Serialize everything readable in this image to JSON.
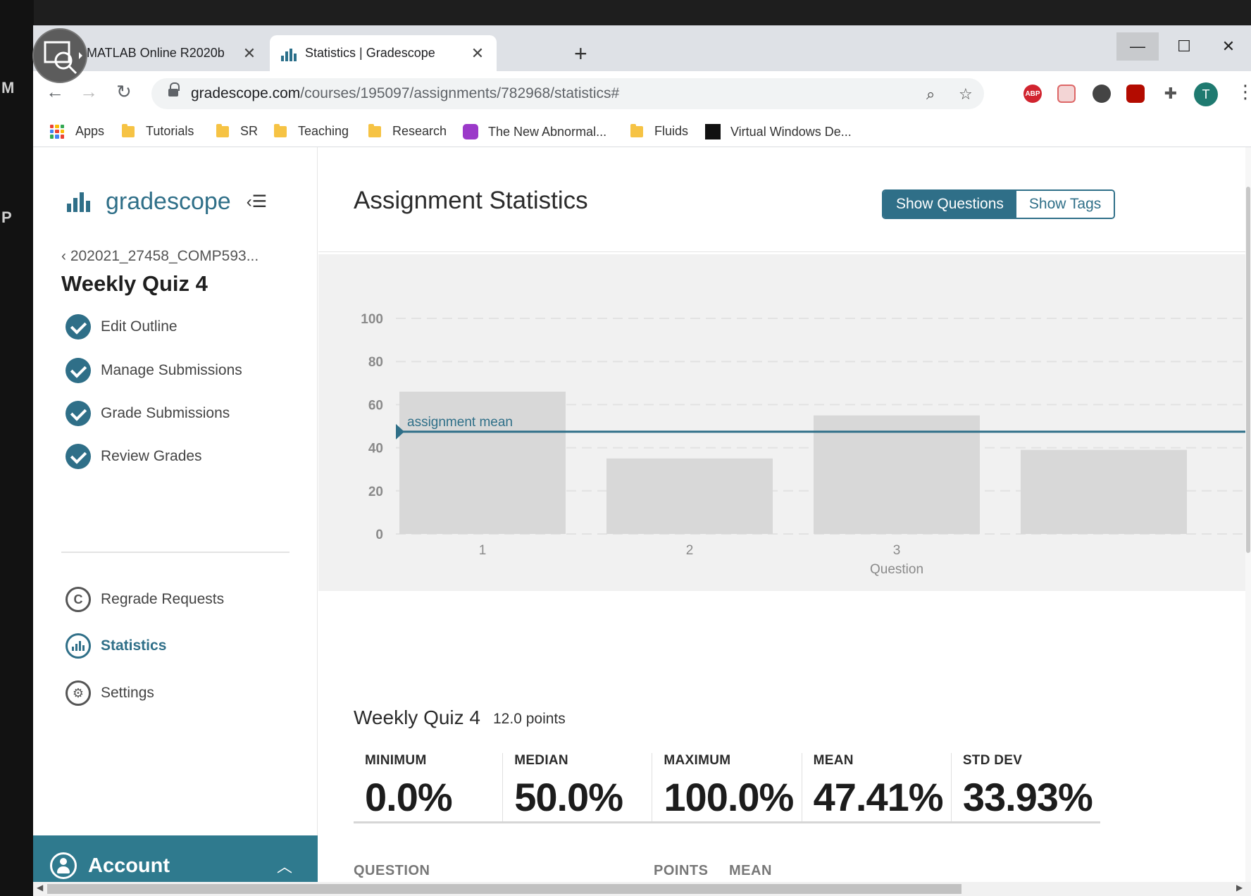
{
  "desktop": {
    "letters": [
      "M",
      "P"
    ]
  },
  "browser": {
    "tabs": [
      {
        "title": "MATLAB Online R2020b",
        "active": false
      },
      {
        "title": "Statistics | Gradescope",
        "active": true
      }
    ],
    "new_tab_label": "+",
    "url": {
      "host": "gradescope.com",
      "path": "/courses/195097/assignments/782968/statistics#"
    },
    "extensions": [
      "zoom-icon",
      "star-icon",
      "adblock-icon",
      "extension-red-icon",
      "extension-circle-icon",
      "acrobat-icon",
      "puzzle-icon"
    ],
    "extension_labels": {
      "adblock": "ABP"
    },
    "profile_initial": "T",
    "bookmarks": [
      "Apps",
      "Tutorials",
      "SR",
      "Teaching",
      "Research",
      "The New Abnormal...",
      "Fluids",
      "Virtual Windows De..."
    ]
  },
  "sidebar": {
    "brand": "gradescope",
    "course": "202021_27458_COMP593...",
    "assignment": "Weekly Quiz 4",
    "steps": [
      "Edit Outline",
      "Manage Submissions",
      "Grade Submissions",
      "Review Grades"
    ],
    "tools": [
      {
        "label": "Regrade Requests",
        "icon": "regrade-icon",
        "active": false
      },
      {
        "label": "Statistics",
        "icon": "statistics-icon",
        "active": true
      },
      {
        "label": "Settings",
        "icon": "gear-icon",
        "active": false
      }
    ],
    "account_label": "Account"
  },
  "main": {
    "title": "Assignment Statistics",
    "toggle": {
      "questions": "Show Questions",
      "tags": "Show Tags",
      "selected": "questions"
    },
    "summary": {
      "name": "Weekly Quiz 4",
      "points": "12.0 points",
      "stats": [
        {
          "label": "MINIMUM",
          "value": "0.0%"
        },
        {
          "label": "MEDIAN",
          "value": "50.0%"
        },
        {
          "label": "MAXIMUM",
          "value": "100.0%"
        },
        {
          "label": "MEAN",
          "value": "47.41%"
        },
        {
          "label": "STD DEV",
          "value": "33.93%"
        }
      ]
    },
    "table_headers": {
      "question": "QUESTION",
      "points": "POINTS",
      "mean": "MEAN"
    }
  },
  "colors": {
    "brand": "#2f6f88",
    "account_bg": "#2f7a8e",
    "bar": "#d8d8d8",
    "chart_bg": "#f1f1f1"
  },
  "chart_data": {
    "type": "bar",
    "categories": [
      "1",
      "2",
      "3",
      "4"
    ],
    "values": [
      66,
      35,
      55,
      39
    ],
    "xlabel": "Question",
    "ylabel": "",
    "ylim": [
      0,
      100
    ],
    "yticks": [
      0,
      20,
      40,
      60,
      80,
      100
    ],
    "tick_labels_visible": [
      "1",
      "2",
      "3"
    ],
    "grid": true,
    "reference_line": {
      "label": "assignment mean",
      "value": 47.41
    }
  }
}
